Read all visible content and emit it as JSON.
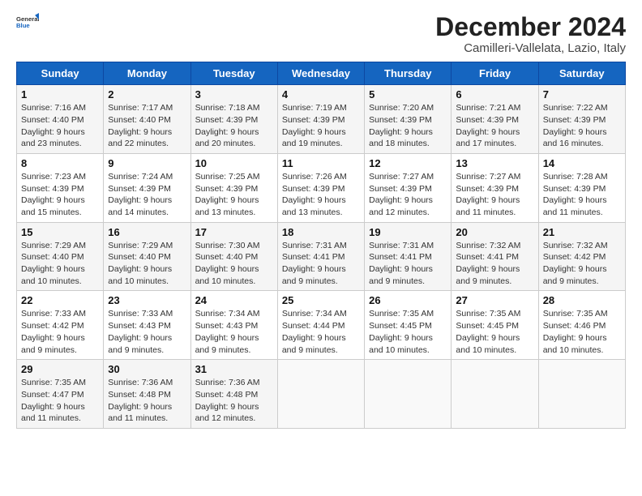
{
  "header": {
    "logo_general": "General",
    "logo_blue": "Blue",
    "month_title": "December 2024",
    "location": "Camilleri-Vallelata, Lazio, Italy"
  },
  "weekdays": [
    "Sunday",
    "Monday",
    "Tuesday",
    "Wednesday",
    "Thursday",
    "Friday",
    "Saturday"
  ],
  "weeks": [
    [
      {
        "day": "1",
        "sunrise": "7:16 AM",
        "sunset": "4:40 PM",
        "daylight": "9 hours and 23 minutes."
      },
      {
        "day": "2",
        "sunrise": "7:17 AM",
        "sunset": "4:40 PM",
        "daylight": "9 hours and 22 minutes."
      },
      {
        "day": "3",
        "sunrise": "7:18 AM",
        "sunset": "4:39 PM",
        "daylight": "9 hours and 20 minutes."
      },
      {
        "day": "4",
        "sunrise": "7:19 AM",
        "sunset": "4:39 PM",
        "daylight": "9 hours and 19 minutes."
      },
      {
        "day": "5",
        "sunrise": "7:20 AM",
        "sunset": "4:39 PM",
        "daylight": "9 hours and 18 minutes."
      },
      {
        "day": "6",
        "sunrise": "7:21 AM",
        "sunset": "4:39 PM",
        "daylight": "9 hours and 17 minutes."
      },
      {
        "day": "7",
        "sunrise": "7:22 AM",
        "sunset": "4:39 PM",
        "daylight": "9 hours and 16 minutes."
      }
    ],
    [
      {
        "day": "8",
        "sunrise": "7:23 AM",
        "sunset": "4:39 PM",
        "daylight": "9 hours and 15 minutes."
      },
      {
        "day": "9",
        "sunrise": "7:24 AM",
        "sunset": "4:39 PM",
        "daylight": "9 hours and 14 minutes."
      },
      {
        "day": "10",
        "sunrise": "7:25 AM",
        "sunset": "4:39 PM",
        "daylight": "9 hours and 13 minutes."
      },
      {
        "day": "11",
        "sunrise": "7:26 AM",
        "sunset": "4:39 PM",
        "daylight": "9 hours and 13 minutes."
      },
      {
        "day": "12",
        "sunrise": "7:27 AM",
        "sunset": "4:39 PM",
        "daylight": "9 hours and 12 minutes."
      },
      {
        "day": "13",
        "sunrise": "7:27 AM",
        "sunset": "4:39 PM",
        "daylight": "9 hours and 11 minutes."
      },
      {
        "day": "14",
        "sunrise": "7:28 AM",
        "sunset": "4:39 PM",
        "daylight": "9 hours and 11 minutes."
      }
    ],
    [
      {
        "day": "15",
        "sunrise": "7:29 AM",
        "sunset": "4:40 PM",
        "daylight": "9 hours and 10 minutes."
      },
      {
        "day": "16",
        "sunrise": "7:29 AM",
        "sunset": "4:40 PM",
        "daylight": "9 hours and 10 minutes."
      },
      {
        "day": "17",
        "sunrise": "7:30 AM",
        "sunset": "4:40 PM",
        "daylight": "9 hours and 10 minutes."
      },
      {
        "day": "18",
        "sunrise": "7:31 AM",
        "sunset": "4:41 PM",
        "daylight": "9 hours and 9 minutes."
      },
      {
        "day": "19",
        "sunrise": "7:31 AM",
        "sunset": "4:41 PM",
        "daylight": "9 hours and 9 minutes."
      },
      {
        "day": "20",
        "sunrise": "7:32 AM",
        "sunset": "4:41 PM",
        "daylight": "9 hours and 9 minutes."
      },
      {
        "day": "21",
        "sunrise": "7:32 AM",
        "sunset": "4:42 PM",
        "daylight": "9 hours and 9 minutes."
      }
    ],
    [
      {
        "day": "22",
        "sunrise": "7:33 AM",
        "sunset": "4:42 PM",
        "daylight": "9 hours and 9 minutes."
      },
      {
        "day": "23",
        "sunrise": "7:33 AM",
        "sunset": "4:43 PM",
        "daylight": "9 hours and 9 minutes."
      },
      {
        "day": "24",
        "sunrise": "7:34 AM",
        "sunset": "4:43 PM",
        "daylight": "9 hours and 9 minutes."
      },
      {
        "day": "25",
        "sunrise": "7:34 AM",
        "sunset": "4:44 PM",
        "daylight": "9 hours and 9 minutes."
      },
      {
        "day": "26",
        "sunrise": "7:35 AM",
        "sunset": "4:45 PM",
        "daylight": "9 hours and 10 minutes."
      },
      {
        "day": "27",
        "sunrise": "7:35 AM",
        "sunset": "4:45 PM",
        "daylight": "9 hours and 10 minutes."
      },
      {
        "day": "28",
        "sunrise": "7:35 AM",
        "sunset": "4:46 PM",
        "daylight": "9 hours and 10 minutes."
      }
    ],
    [
      {
        "day": "29",
        "sunrise": "7:35 AM",
        "sunset": "4:47 PM",
        "daylight": "9 hours and 11 minutes."
      },
      {
        "day": "30",
        "sunrise": "7:36 AM",
        "sunset": "4:48 PM",
        "daylight": "9 hours and 11 minutes."
      },
      {
        "day": "31",
        "sunrise": "7:36 AM",
        "sunset": "4:48 PM",
        "daylight": "9 hours and 12 minutes."
      },
      null,
      null,
      null,
      null
    ]
  ],
  "labels": {
    "sunrise": "Sunrise:",
    "sunset": "Sunset:",
    "daylight": "Daylight:"
  }
}
